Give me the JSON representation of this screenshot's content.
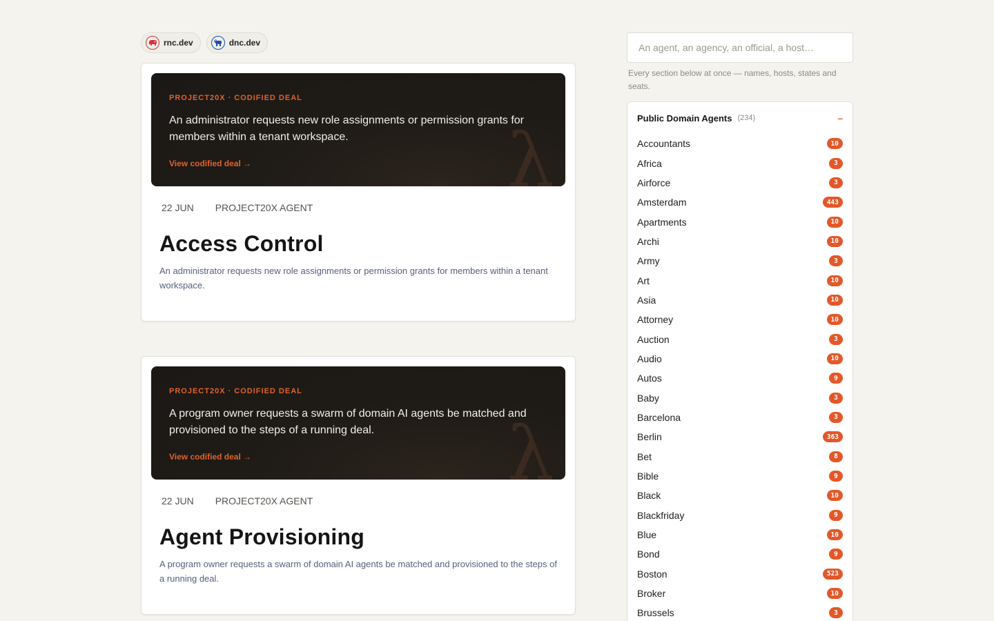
{
  "pills": [
    {
      "label": "rnc.dev",
      "icon": "elephant-icon",
      "color": "#d8323b"
    },
    {
      "label": "dnc.dev",
      "icon": "donkey-icon",
      "color": "#1f4db0"
    }
  ],
  "cards": [
    {
      "eyebrow": "PROJECT20X · CODIFIED DEAL",
      "summary": "An administrator requests new role assignments or permission grants for members within a tenant workspace.",
      "cta": "View codified deal →",
      "date": "22 JUN",
      "author": "PROJECT20X AGENT",
      "title": "Access Control",
      "description": "An administrator requests new role assignments or permission grants for members within a tenant workspace."
    },
    {
      "eyebrow": "PROJECT20X · CODIFIED DEAL",
      "summary": "A program owner requests a swarm of domain AI agents be matched and provisioned to the steps of a running deal.",
      "cta": "View codified deal →",
      "date": "22 JUN",
      "author": "PROJECT20X AGENT",
      "title": "Agent Provisioning",
      "description": "A program owner requests a swarm of domain AI agents be matched and provisioned to the steps of a running deal."
    }
  ],
  "search": {
    "placeholder": "An agent, an agency, an official, a host…",
    "hint": "Every section below at once — names, hosts, states and seats."
  },
  "panel": {
    "title": "Public Domain Agents",
    "count": "(234)",
    "collapse": "–",
    "items": [
      {
        "name": "Accountants",
        "count": "10"
      },
      {
        "name": "Africa",
        "count": "3"
      },
      {
        "name": "Airforce",
        "count": "3"
      },
      {
        "name": "Amsterdam",
        "count": "443"
      },
      {
        "name": "Apartments",
        "count": "10"
      },
      {
        "name": "Archi",
        "count": "10"
      },
      {
        "name": "Army",
        "count": "3"
      },
      {
        "name": "Art",
        "count": "10"
      },
      {
        "name": "Asia",
        "count": "10"
      },
      {
        "name": "Attorney",
        "count": "10"
      },
      {
        "name": "Auction",
        "count": "3"
      },
      {
        "name": "Audio",
        "count": "10"
      },
      {
        "name": "Autos",
        "count": "9"
      },
      {
        "name": "Baby",
        "count": "3"
      },
      {
        "name": "Barcelona",
        "count": "3"
      },
      {
        "name": "Berlin",
        "count": "363"
      },
      {
        "name": "Bet",
        "count": "8"
      },
      {
        "name": "Bible",
        "count": "9"
      },
      {
        "name": "Black",
        "count": "10"
      },
      {
        "name": "Blackfriday",
        "count": "9"
      },
      {
        "name": "Blue",
        "count": "10"
      },
      {
        "name": "Bond",
        "count": "9"
      },
      {
        "name": "Boston",
        "count": "523"
      },
      {
        "name": "Broker",
        "count": "10"
      },
      {
        "name": "Brussels",
        "count": "3"
      }
    ]
  },
  "colors": {
    "accent": "#e0632c",
    "badge": "#e2582a",
    "background": "#f4f3ee",
    "hero": "#1f1b17"
  }
}
